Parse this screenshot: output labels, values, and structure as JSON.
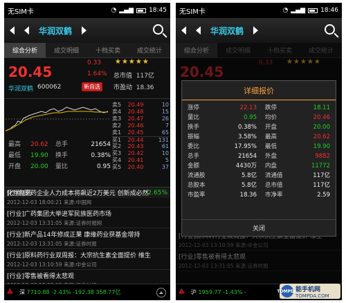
{
  "status": {
    "left": {
      "carrier": "无SIM卡",
      "time": "18:45"
    },
    "right": {
      "carrier": "无SIM卡",
      "time": "18:46"
    }
  },
  "stock": {
    "name": "华润双鹤",
    "code": "600062",
    "price": "20.45",
    "change": "0.33",
    "pct": "1.64%",
    "stars": "★★★★★",
    "mv_label": "总市值",
    "mv": "117亿",
    "pe_label": "市盈动",
    "pe": "18.36",
    "add_label": "新自选"
  },
  "tabs": [
    "综合分析",
    "成交明细",
    "十档买卖",
    "成交统计"
  ],
  "depth": [
    {
      "lv": "卖5",
      "p": "20.49",
      "v": "10",
      "c": "red"
    },
    {
      "lv": "卖4",
      "p": "20.48",
      "v": "15",
      "c": "red"
    },
    {
      "lv": "卖3",
      "p": "20.47",
      "v": "26",
      "c": "red"
    },
    {
      "lv": "卖2",
      "p": "20.46",
      "v": "7",
      "c": "red"
    },
    {
      "lv": "卖1",
      "p": "20.45",
      "v": "65",
      "c": "red"
    },
    {
      "lv": "买1",
      "p": "20.44",
      "v": "131",
      "c": "red"
    },
    {
      "lv": "买2",
      "p": "20.43",
      "v": "61",
      "c": "red"
    },
    {
      "lv": "买3",
      "p": "20.42",
      "v": "10",
      "c": "red"
    },
    {
      "lv": "买4",
      "p": "20.41",
      "v": "5",
      "c": "red"
    },
    {
      "lv": "买5",
      "p": "20.40",
      "v": "37",
      "c": "red"
    }
  ],
  "stats": [
    {
      "k": "最高",
      "v": "20.62",
      "vc": "red",
      "k2": "总手",
      "v2": "21654",
      "v2c": "white"
    },
    {
      "k": "最低",
      "v": "19.90",
      "vc": "green",
      "k2": "换手",
      "v2": "0.38%",
      "v2c": "white"
    },
    {
      "k": "开盘",
      "v": "20.00",
      "vc": "green",
      "k2": "量比",
      "v2": "0.95",
      "v2c": "white"
    }
  ],
  "sector": {
    "name": "化学制药",
    "pct": "-2.65%"
  },
  "news": [
    {
      "t": "[行业]医药企业人力成本将飙近2万美元 创新成必然",
      "m": "2012-12-03 18:00:21 来源:中国网"
    },
    {
      "t": "[行业]广药集团大举进军民族医药市场",
      "m": "2012-12-03 13:31:05 来源:证券时报网"
    },
    {
      "t": "[行业]新产品14年修成正果 康缘药业获基金增持",
      "m": "2012-12-03 13:31:05 来源:证券时报"
    },
    {
      "t": "[行业]原料药行业双周报：大宗抗生素全面提价 维生",
      "m": "2012-12-03 13:10:59 来源:中金公司"
    },
    {
      "t": "[行业]零售被看得太悲观",
      "m": "2012-12-03 13:31:05 来源:证券时报"
    }
  ],
  "bottom": {
    "left": {
      "mkt": "深",
      "text": "7710.88 -2.43% -192.38 358.77亿"
    },
    "right": {
      "mkt": "沪",
      "text": "1959.77 -1.43% -"
    }
  },
  "dialog": {
    "title": "详细报价",
    "rows": [
      {
        "k": "涨停",
        "v": "22.13",
        "vc": "red",
        "k2": "跌停",
        "v2": "18.11",
        "v2c": "green"
      },
      {
        "k": "量比",
        "v": "0.95",
        "vc": "green",
        "k2": "均价",
        "v2": "20.46",
        "v2c": "red"
      },
      {
        "k": "换手",
        "v": "0.38%",
        "vc": "white",
        "k2": "开盘",
        "v2": "20.00",
        "v2c": "green"
      },
      {
        "k": "振幅",
        "v": "3.58%",
        "vc": "white",
        "k2": "最高",
        "v2": "20.62",
        "v2c": "red"
      },
      {
        "k": "委比",
        "v": "17.95%",
        "vc": "white",
        "k2": "最低",
        "v2": "19.90",
        "v2c": "green"
      },
      {
        "k": "总手",
        "v": "21654",
        "vc": "white",
        "k2": "外盘",
        "v2": "9882",
        "v2c": "red"
      },
      {
        "k": "金额",
        "v": "4430万",
        "vc": "white",
        "k2": "内盘",
        "v2": "11772",
        "v2c": "green"
      },
      {
        "k": "流通股",
        "v": "5.8亿",
        "vc": "white",
        "k2": "流通值",
        "v2": "117亿",
        "v2c": "white"
      },
      {
        "k": "总股本",
        "v": "5.8亿",
        "vc": "white",
        "k2": "总市值",
        "v2": "117亿",
        "v2c": "white"
      },
      {
        "k": "市盈率",
        "v": "18.36",
        "vc": "white",
        "k2": "市净率",
        "v2": "2.59",
        "v2c": "white"
      }
    ],
    "close": "关闭"
  },
  "watermark": {
    "t1": "能手机网",
    "t2": "TOMPDA.COM",
    "badge": "TOMPDA"
  }
}
